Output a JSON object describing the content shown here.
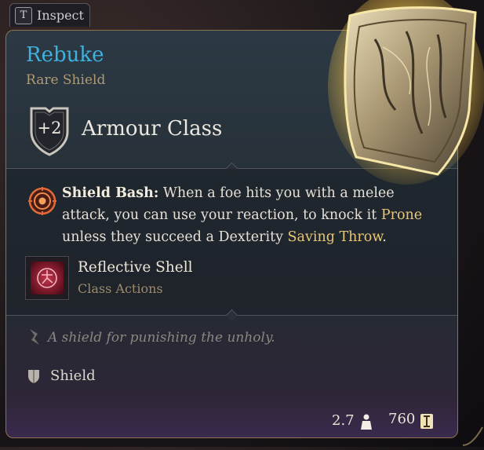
{
  "inspect": {
    "key": "T",
    "label": "Inspect"
  },
  "item": {
    "name": "Rebuke",
    "rarity": "Rare Shield",
    "armour_class_value": "+2",
    "armour_class_label": "Armour Class"
  },
  "passive": {
    "name": "Shield Bash:",
    "text_1": " When a foe hits you with a melee attack, you can use your reaction, to knock it ",
    "keyword_1": "Prone",
    "text_2": " unless they succeed a Dexterity ",
    "keyword_2": "Saving Throw",
    "text_3": "."
  },
  "action": {
    "name": "Reflective Shell",
    "category": "Class Actions"
  },
  "flavor": "A shield for punishing the unholy.",
  "type": "Shield",
  "weight": "2.7",
  "price": "760",
  "colors": {
    "title": "#3fb1de",
    "rarity": "#b09a72",
    "keyword": "#e8c877",
    "border": "#8a7550"
  }
}
